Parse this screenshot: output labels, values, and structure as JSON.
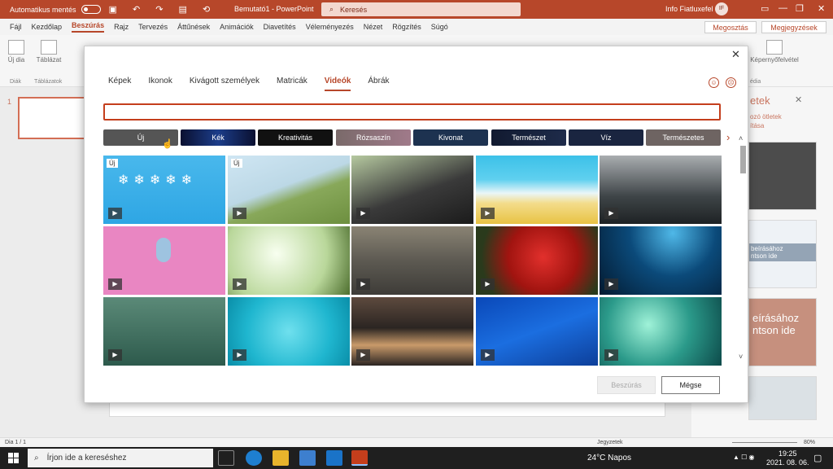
{
  "titlebar": {
    "autosave_label": "Automatikus mentés",
    "doc_title": "Bemutató1  -  PowerPoint",
    "search_placeholder": "Keresés",
    "user_name": "Info Fiatluxefel",
    "user_initials": "IF"
  },
  "ribbon_tabs": [
    "Fájl",
    "Kezdőlap",
    "Beszúrás",
    "Rajz",
    "Tervezés",
    "Áttűnések",
    "Animációk",
    "Diavetítés",
    "Véleményezés",
    "Nézet",
    "Rögzítés",
    "Súgó"
  ],
  "ribbon_active_tab": "Beszúrás",
  "share_label": "Megosztás",
  "comments_label": "Megjegyzések",
  "ribbon": {
    "new_slide": "Új dia",
    "table": "Táblázat",
    "group_slides": "Diák",
    "group_tables": "Táblázatok",
    "camera": "Képernyőfelvétel",
    "group_media": "édia"
  },
  "slide_number": "1",
  "designer": {
    "title": "etek",
    "link1": "ozó ötletek",
    "link2": "ítása",
    "thumb_text1": "beírásához",
    "thumb_text2": "ntson ide",
    "thumb_text3": "eírásához",
    "thumb_text4": "ntson ide"
  },
  "statusbar": {
    "slide_info": "Dia 1 / 1",
    "notes_label": "Jegyzetek",
    "zoom": "80%"
  },
  "taskbar": {
    "search_placeholder": "Írjon ide a kereséshez",
    "weather": "24°C  Napos",
    "time": "19:25",
    "date": "2021. 08. 06."
  },
  "dialog": {
    "tabs": [
      "Képek",
      "Ikonok",
      "Kivágott személyek",
      "Matricák",
      "Videók",
      "Ábrák"
    ],
    "active_tab": "Videók",
    "search_value": "",
    "categories": [
      "Új",
      "Kék",
      "Kreativitás",
      "Rózsaszín",
      "Kivonat",
      "Természet",
      "Víz",
      "Természetes"
    ],
    "new_badge": "Új",
    "insert_label": "Beszúrás",
    "cancel_label": "Mégse"
  },
  "colors": {
    "brand": "#b7472a",
    "accent": "#c43e1c"
  }
}
